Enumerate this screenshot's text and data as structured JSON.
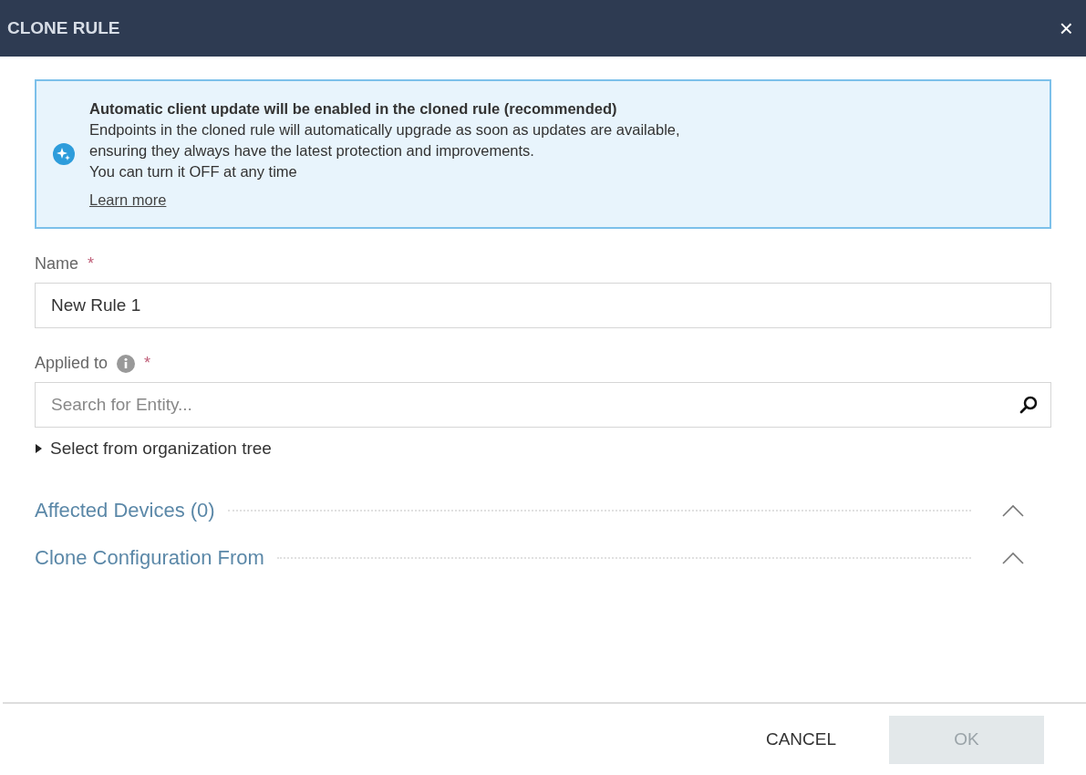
{
  "window": {
    "title": "CLONE RULE",
    "close": "×"
  },
  "banner": {
    "title": "Automatic client update will be enabled in the cloned rule (recommended)",
    "lines": [
      "Endpoints in the cloned rule will automatically upgrade as soon as updates are available,",
      "ensuring they always have the latest protection and improvements.",
      "You can turn it OFF at any time"
    ],
    "link": "Learn more"
  },
  "name_field": {
    "label": "Name",
    "required": "*",
    "value": "New Rule 1"
  },
  "applied_to": {
    "label": "Applied to",
    "required": "*",
    "placeholder": "Search for Entity...",
    "tree_toggle": {
      "label": "Select from organization tree",
      "expanded": false
    }
  },
  "sections": [
    {
      "title": "Affected Devices (0)",
      "expanded": true
    },
    {
      "title": "Clone Configuration From",
      "expanded": true
    }
  ],
  "buttons": [
    {
      "label": "CANCEL",
      "kind": "text",
      "disabled": false
    },
    {
      "label": "OK",
      "kind": "primary",
      "disabled": true
    }
  ]
}
